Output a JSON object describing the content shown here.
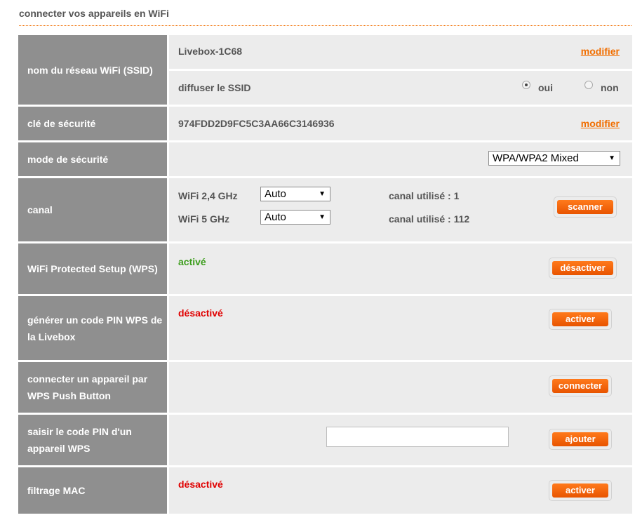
{
  "page": {
    "title": "connecter vos appareils en WiFi"
  },
  "ssid": {
    "label": "nom du réseau WiFi (SSID)",
    "value": "Livebox-1C68",
    "modify_label": "modifier",
    "broadcast_label": "diffuser le SSID",
    "option_yes": "oui",
    "option_no": "non",
    "broadcast_selected": "oui"
  },
  "key": {
    "label": "clé de sécurité",
    "value": "974FDD2D9FC5C3AA66C3146936",
    "modify_label": "modifier"
  },
  "security_mode": {
    "label": "mode de sécurité",
    "selected": "WPA/WPA2 Mixed"
  },
  "channel": {
    "label": "canal",
    "band24_label": "WiFi 2,4 GHz",
    "band24_selected": "Auto",
    "band24_used": "canal utilisé : 1",
    "band5_label": "WiFi 5 GHz",
    "band5_selected": "Auto",
    "band5_used": "canal utilisé : 112",
    "scan_button": "scanner"
  },
  "wps": {
    "label": "WiFi Protected Setup (WPS)",
    "status": "activé",
    "button": "désactiver"
  },
  "wps_pin": {
    "label": "générer un code PIN WPS de la Livebox",
    "status": "désactivé",
    "button": "activer"
  },
  "wps_push": {
    "label": "connecter un appareil par WPS Push Button",
    "button": "connecter"
  },
  "wps_device_pin": {
    "label": "saisir le code PIN d'un appareil WPS",
    "input_value": "",
    "button": "ajouter"
  },
  "mac_filter": {
    "label": "filtrage MAC",
    "status": "désactivé",
    "button": "activer"
  },
  "colors": {
    "accent": "#f16e00",
    "label_bg": "#8f8f8f",
    "cell_bg": "#ececec",
    "active": "#3c9d1c",
    "inactive": "#e00000"
  }
}
